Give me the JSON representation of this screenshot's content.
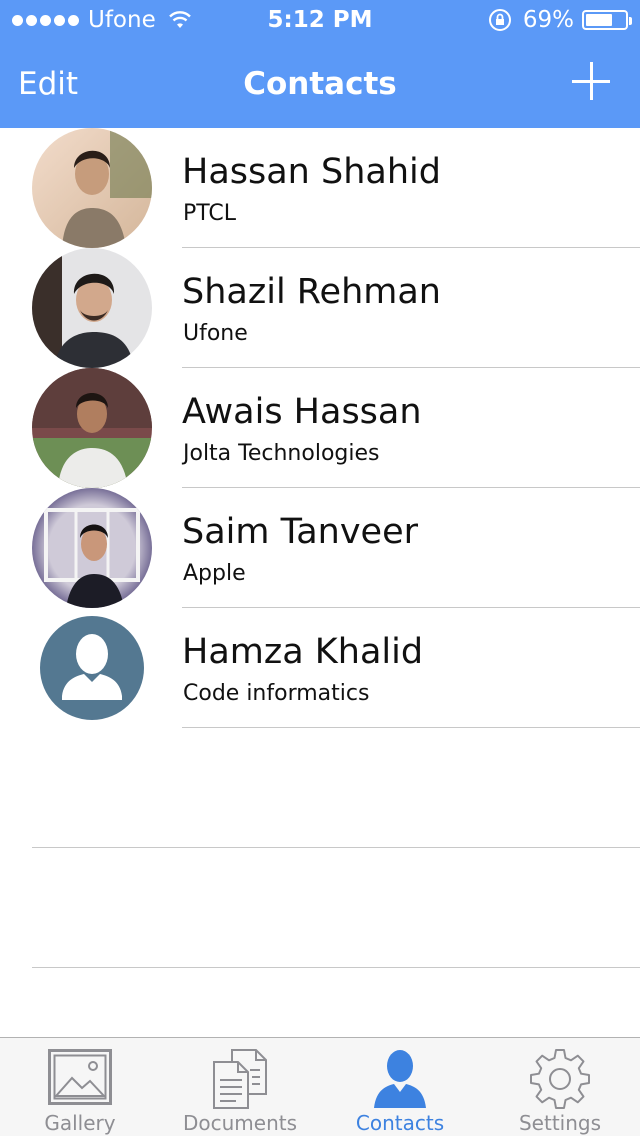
{
  "status_bar": {
    "carrier": "Ufone",
    "time": "5:12 PM",
    "battery_percent": "69%",
    "battery_level": 0.69,
    "signal_bars": 5
  },
  "nav": {
    "left_button": "Edit",
    "title": "Contacts",
    "right_icon": "plus-icon"
  },
  "contacts": [
    {
      "name": "Hassan Shahid",
      "company": "PTCL",
      "avatar": "photo"
    },
    {
      "name": "Shazil Rehman",
      "company": "Ufone",
      "avatar": "photo"
    },
    {
      "name": "Awais Hassan",
      "company": "Jolta Technologies",
      "avatar": "photo"
    },
    {
      "name": "Saim Tanveer",
      "company": "Apple",
      "avatar": "photo"
    },
    {
      "name": "Hamza Khalid",
      "company": "Code informatics",
      "avatar": "placeholder-person-icon"
    }
  ],
  "tabs": [
    {
      "label": "Gallery",
      "icon": "gallery-icon",
      "active": false
    },
    {
      "label": "Documents",
      "icon": "documents-icon",
      "active": false
    },
    {
      "label": "Contacts",
      "icon": "contacts-icon",
      "active": true
    },
    {
      "label": "Settings",
      "icon": "settings-gear-icon",
      "active": false
    }
  ],
  "colors": {
    "nav_background": "#5b99f7",
    "tab_active": "#3d82e0",
    "tab_inactive": "#8e8e93",
    "placeholder_avatar": "#547891"
  }
}
